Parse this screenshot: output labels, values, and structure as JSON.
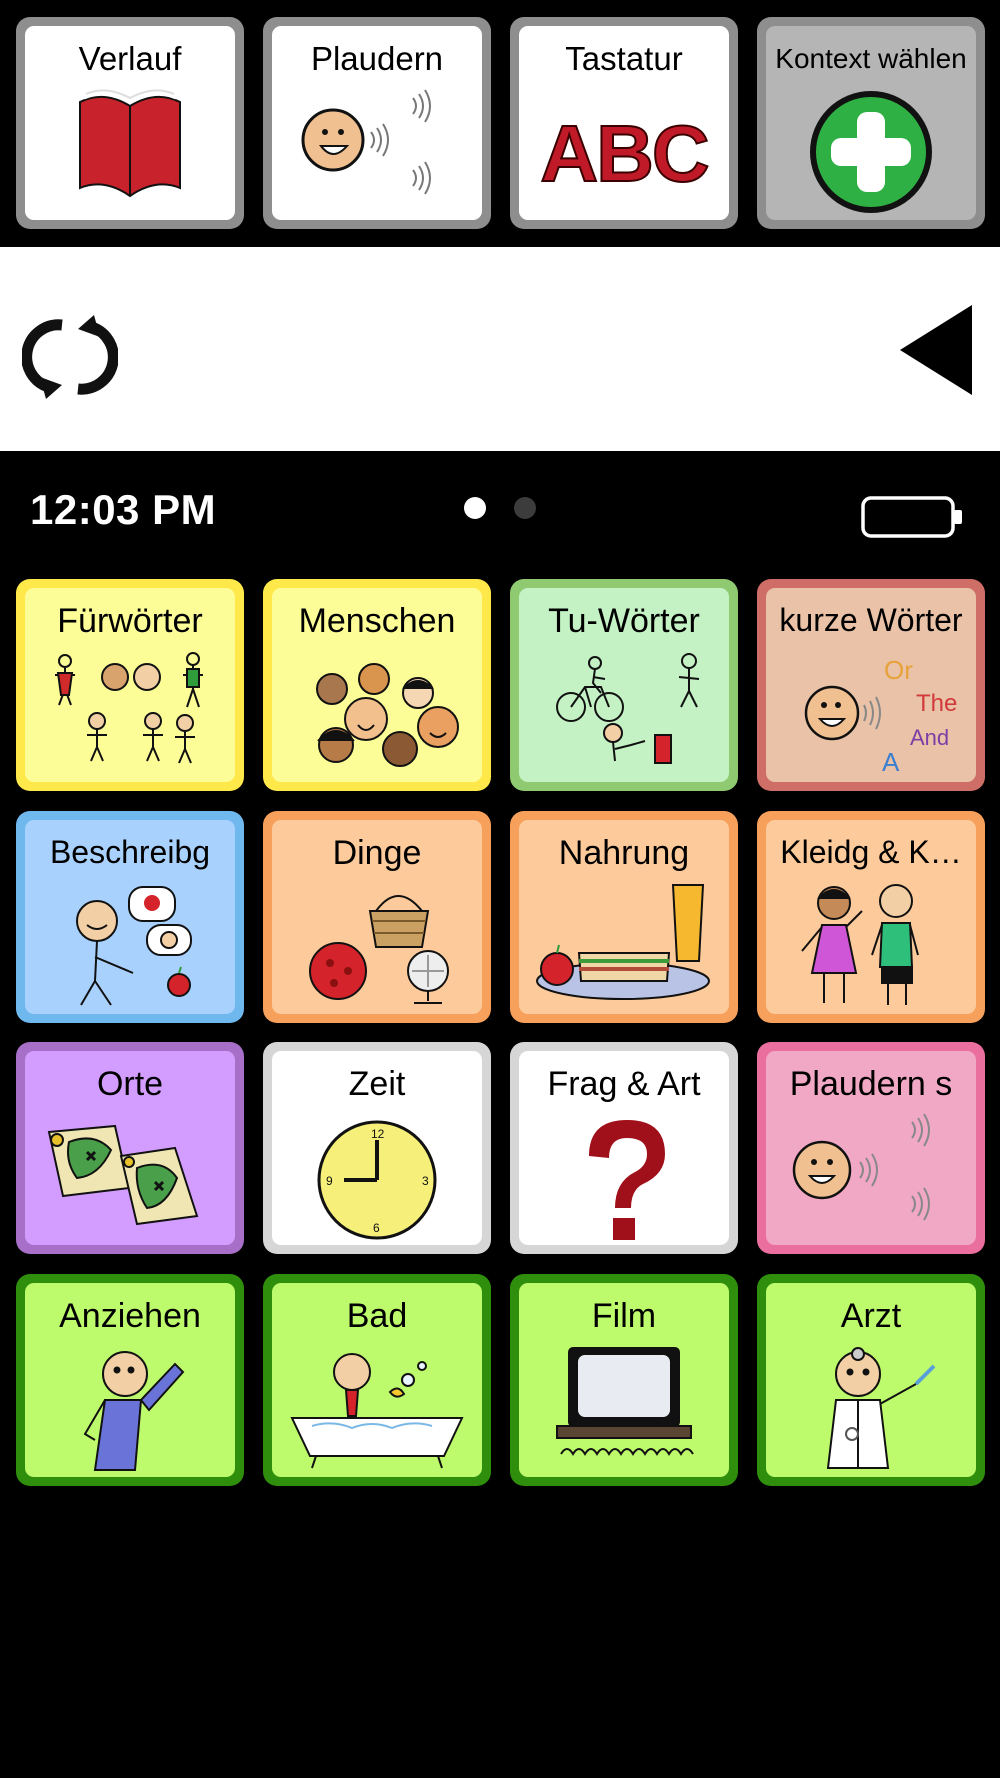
{
  "toolbar": {
    "history_label": "Verlauf",
    "chat_label": "Plaudern",
    "keyboard_label": "Tastatur",
    "keyboard_icon_text": "ABC",
    "context_label": "Kontext wählen"
  },
  "status": {
    "time": "12:03 PM",
    "page_count": 2,
    "current_page": 1
  },
  "grid": {
    "tiles": [
      {
        "label": "Fürwörter",
        "border": "#ffe84a",
        "fill": "#fdfd98"
      },
      {
        "label": "Menschen",
        "border": "#ffe84a",
        "fill": "#fdfd98"
      },
      {
        "label": "Tu-Wörter",
        "border": "#8fca70",
        "fill": "#c4f2c5"
      },
      {
        "label": "kurze Wörter",
        "border": "#cf6e66",
        "fill": "#e9c2a7"
      },
      {
        "label": "Beschreibg",
        "border": "#6fb8ee",
        "fill": "#a9d1fd"
      },
      {
        "label": "Dinge",
        "border": "#f7a05c",
        "fill": "#fdcb9b"
      },
      {
        "label": "Nahrung",
        "border": "#f7a05c",
        "fill": "#fdcb9b"
      },
      {
        "label": "Kleidg & K…",
        "border": "#f7a05c",
        "fill": "#fdcb9b"
      },
      {
        "label": "Orte",
        "border": "#a76fc8",
        "fill": "#d39dff"
      },
      {
        "label": "Zeit",
        "border": "#d6d6d6",
        "fill": "#ffffff"
      },
      {
        "label": "Frag & Art",
        "border": "#d6d6d6",
        "fill": "#ffffff"
      },
      {
        "label": "Plaudern s",
        "border": "#ea6e9e",
        "fill": "#f1a8c4"
      },
      {
        "label": "Anziehen",
        "border": "#2f8e0c",
        "fill": "#befb6c"
      },
      {
        "label": "Bad",
        "border": "#2f8e0c",
        "fill": "#befb6c"
      },
      {
        "label": "Film",
        "border": "#2f8e0c",
        "fill": "#befb6c"
      },
      {
        "label": "Arzt",
        "border": "#2f8e0c",
        "fill": "#befb6c"
      }
    ],
    "short_words": [
      "Or",
      "The",
      "And",
      "A"
    ]
  }
}
